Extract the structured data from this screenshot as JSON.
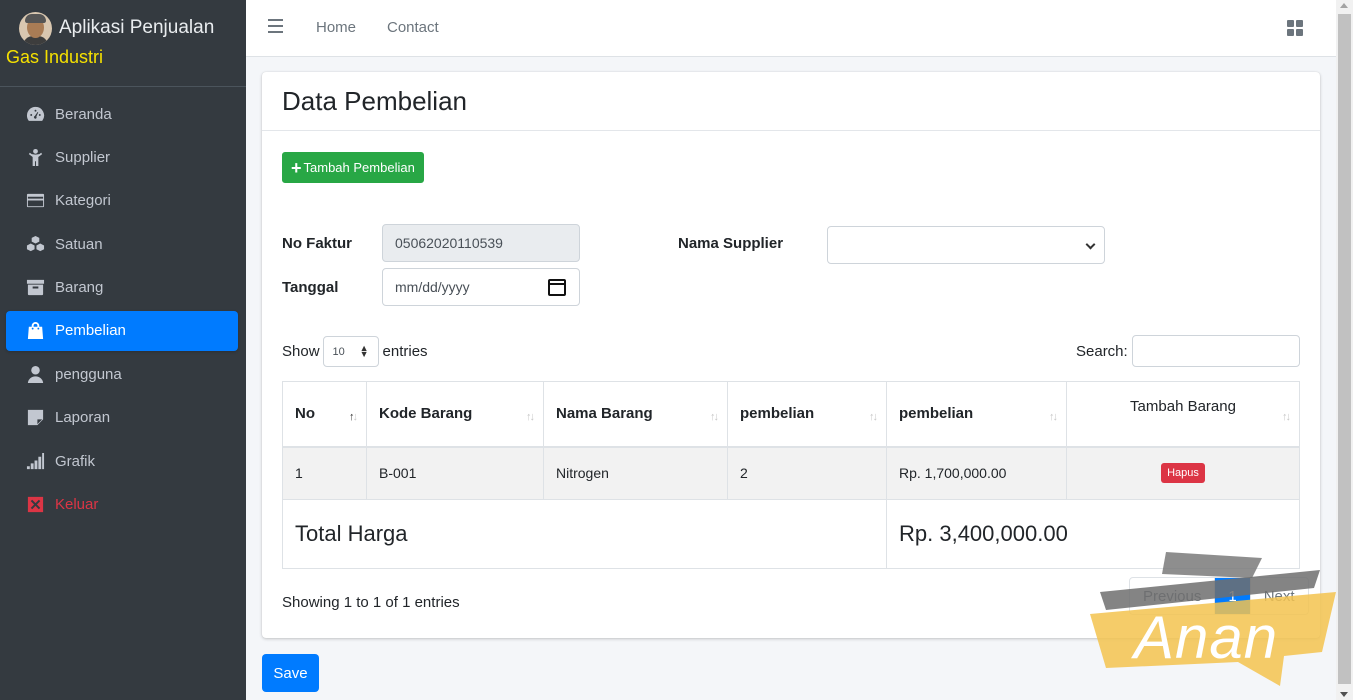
{
  "brand": {
    "title": "Aplikasi Penjualan",
    "subtitle": "Gas Industri"
  },
  "sidebar": {
    "items": [
      {
        "label": "Beranda",
        "icon": "gauge-icon"
      },
      {
        "label": "Supplier",
        "icon": "person-icon"
      },
      {
        "label": "Kategori",
        "icon": "card-icon"
      },
      {
        "label": "Satuan",
        "icon": "cubes-icon"
      },
      {
        "label": "Barang",
        "icon": "archive-icon"
      },
      {
        "label": "Pembelian",
        "icon": "shopping-bag-icon",
        "active": true
      },
      {
        "label": "pengguna",
        "icon": "user-icon"
      },
      {
        "label": "Laporan",
        "icon": "note-icon"
      },
      {
        "label": "Grafik",
        "icon": "signal-icon"
      },
      {
        "label": "Keluar",
        "icon": "close-box-icon",
        "color": "#dc3545"
      }
    ]
  },
  "topbar": {
    "links": [
      "Home",
      "Contact"
    ]
  },
  "page": {
    "title": "Data Pembelian",
    "add_button": "Tambah Pembelian",
    "save_button": "Save"
  },
  "form": {
    "no_faktur_label": "No Faktur",
    "no_faktur_value": "05062020110539",
    "tanggal_label": "Tanggal",
    "tanggal_placeholder": "mm/dd/yyyy",
    "supplier_label": "Nama Supplier",
    "supplier_value": ""
  },
  "table": {
    "show_label": "Show",
    "page_length": "10",
    "entries_label": "entries",
    "search_label": "Search:",
    "columns": [
      "No",
      "Kode Barang",
      "Nama Barang",
      "pembelian",
      "pembelian",
      "Tambah Barang"
    ],
    "rows": [
      {
        "no": "1",
        "kode": "B-001",
        "nama": "Nitrogen",
        "jumlah": "2",
        "harga": "Rp. 1,700,000.00",
        "action": "Hapus"
      }
    ],
    "total_label": "Total Harga",
    "total_value": "Rp. 3,400,000.00",
    "info": "Showing 1 to 1 of 1 entries",
    "pagination": {
      "previous": "Previous",
      "current": "1",
      "next": "Next"
    }
  },
  "watermark": "Anan",
  "colors": {
    "sidebar": "#343a40",
    "primary": "#007bff",
    "success": "#28a745",
    "danger": "#dc3545",
    "brand_subtitle": "#f5e000"
  }
}
